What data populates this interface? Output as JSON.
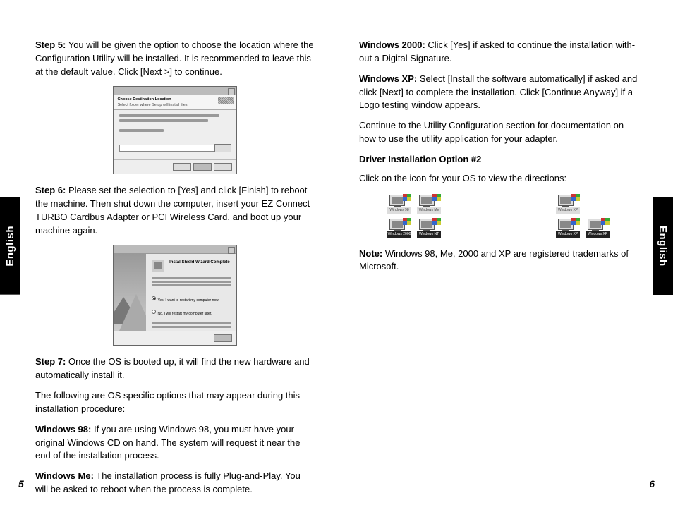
{
  "language_tab": "English",
  "left": {
    "page_number": "5",
    "step5": {
      "label": "Step 5:",
      "text": " You will be given the option to choose the location where the Configuration Utility will be installed. It is recommended to leave this at the default value. Click [Next >] to continue."
    },
    "screenshot1_title": "Choose Destination Location",
    "step6": {
      "label": "Step 6:",
      "text": " Please set the selection to [Yes] and click [Finish] to reboot the machine. Then shut down the computer, insert your EZ Connect TURBO Cardbus Adapter or PCI Wireless Card, and boot up your machine again."
    },
    "screenshot2_title": "InstallShield Wizard Complete",
    "step7": {
      "label": "Step 7:",
      "text": " Once the OS is booted up, it will find the new hardware and automatically install it."
    },
    "os_intro": "The following are OS specific options that may appear during this installation procedure:",
    "win98": {
      "label": "Windows 98:",
      "text": " If you are using Windows 98, you must have your original Windows CD on hand. The system will request it near the end of the installation process."
    },
    "winme": {
      "label": "Windows Me:",
      "text": " The installation process is fully Plug-and-Play. You will be asked to reboot when the process is complete."
    }
  },
  "right": {
    "page_number": "6",
    "win2000": {
      "label": "Windows 2000:",
      "text": " Click [Yes] if asked to continue the installation with-out a Digital Signature."
    },
    "winxp": {
      "label": "Windows XP:",
      "text": " Select [Install the software automatically] if asked and click [Next] to complete the installation. Click [Continue Anyway] if a Logo testing window appears."
    },
    "continue_text": "Continue to the Utility Configuration section for documentation on how to use the utility application for your adapter.",
    "driver_heading": "Driver Installation Option #2",
    "driver_instruction": "Click on the icon for your OS to view the directions:",
    "icons": {
      "a1": "Windows 98",
      "a2": "Windows Me",
      "a3": "Windows 2000",
      "a4": "Windows NT",
      "b1": "Windows XP",
      "b2": "Windows XP"
    },
    "note": {
      "label": "Note:",
      "text": " Windows 98, Me, 2000 and XP are registered trademarks of Microsoft."
    }
  }
}
